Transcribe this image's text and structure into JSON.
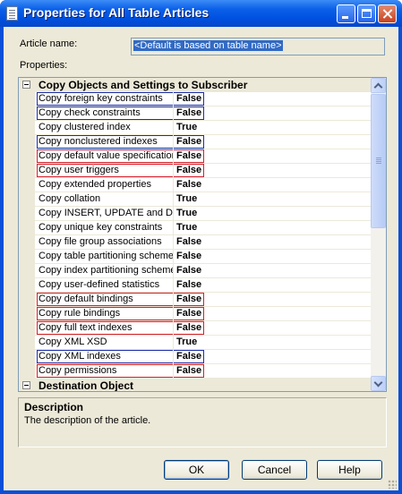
{
  "window": {
    "title": "Properties for All Table Articles"
  },
  "article_name": {
    "label": "Article name:",
    "value": "<Default is based on table name>"
  },
  "properties_label": "Properties:",
  "grid": {
    "category1": "Copy Objects and Settings to Subscriber",
    "category2": "Destination Object",
    "rows": [
      {
        "name": "Copy foreign key constraints",
        "value": "False",
        "highlight": "blue"
      },
      {
        "name": "Copy check constraints",
        "value": "False",
        "highlight": "blue"
      },
      {
        "name": "Copy clustered index",
        "value": "True",
        "highlight": ""
      },
      {
        "name": "Copy nonclustered indexes",
        "value": "False",
        "highlight": "blue"
      },
      {
        "name": "Copy default value specifications",
        "value": "False",
        "highlight": "red"
      },
      {
        "name": "Copy user triggers",
        "value": "False",
        "highlight": "red"
      },
      {
        "name": "Copy extended properties",
        "value": "False",
        "highlight": ""
      },
      {
        "name": "Copy collation",
        "value": "True",
        "highlight": ""
      },
      {
        "name": "Copy INSERT, UPDATE and DELETE stored procedures",
        "value": "True",
        "highlight": ""
      },
      {
        "name": "Copy unique key constraints",
        "value": "True",
        "highlight": ""
      },
      {
        "name": "Copy file group associations",
        "value": "False",
        "highlight": ""
      },
      {
        "name": "Copy table partitioning schemes",
        "value": "False",
        "highlight": ""
      },
      {
        "name": "Copy index partitioning schemes",
        "value": "False",
        "highlight": ""
      },
      {
        "name": "Copy user-defined statistics",
        "value": "False",
        "highlight": ""
      },
      {
        "name": "Copy default bindings",
        "value": "False",
        "highlight": "red"
      },
      {
        "name": "Copy rule bindings",
        "value": "False",
        "highlight": "red"
      },
      {
        "name": "Copy full text indexes",
        "value": "False",
        "highlight": "red"
      },
      {
        "name": "Copy XML XSD",
        "value": "True",
        "highlight": ""
      },
      {
        "name": "Copy XML indexes",
        "value": "False",
        "highlight": "blue"
      },
      {
        "name": "Copy permissions",
        "value": "False",
        "highlight": "red"
      }
    ]
  },
  "description": {
    "title": "Description",
    "text": "The description of the article."
  },
  "buttons": {
    "ok": "OK",
    "cancel": "Cancel",
    "help": "Help"
  },
  "colors": {
    "highlight_blue": "#1c2ea8",
    "highlight_red": "#d4202a",
    "titlebar": "#0a5fe8"
  }
}
